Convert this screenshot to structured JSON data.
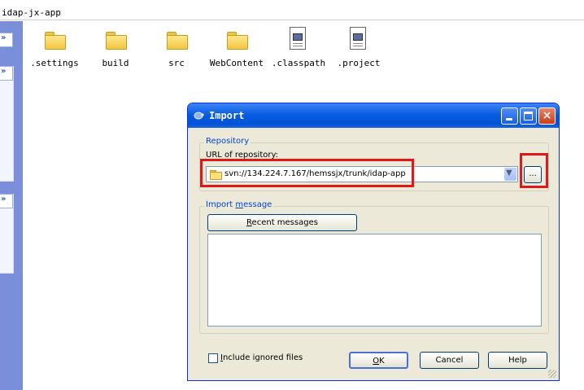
{
  "address_bar": {
    "path": "idap-jx-app"
  },
  "files": [
    {
      "name": ".settings",
      "icon": "folder-icon"
    },
    {
      "name": "build",
      "icon": "folder-icon"
    },
    {
      "name": "src",
      "icon": "folder-icon"
    },
    {
      "name": "WebContent",
      "icon": "folder-icon"
    },
    {
      "name": ".classpath",
      "icon": "file-icon"
    },
    {
      "name": ".project",
      "icon": "file-icon"
    }
  ],
  "dialog": {
    "title": "Import",
    "repository": {
      "legend": "Repository",
      "url_label": "URL of repository:",
      "url_value": "svn://134.224.7.167/hemssjx/trunk/idap-app",
      "browse_label": "..."
    },
    "import_message": {
      "legend_pre": "Import ",
      "legend_ul": "m",
      "legend_post": "essage",
      "recent_pre": "",
      "recent_ul": "R",
      "recent_post": "ecent messages",
      "text": ""
    },
    "include_ignored": {
      "pre": "",
      "ul": "I",
      "post": "nclude ignored files",
      "checked": false
    },
    "buttons": {
      "ok_ul": "O",
      "ok_post": "K",
      "cancel": "Cancel",
      "help": "Help"
    }
  },
  "colors": {
    "titlebar": "#0a5ce0",
    "dialog_bg": "#ece9d8",
    "highlight": "#e01818",
    "group_legend": "#0046d5"
  }
}
